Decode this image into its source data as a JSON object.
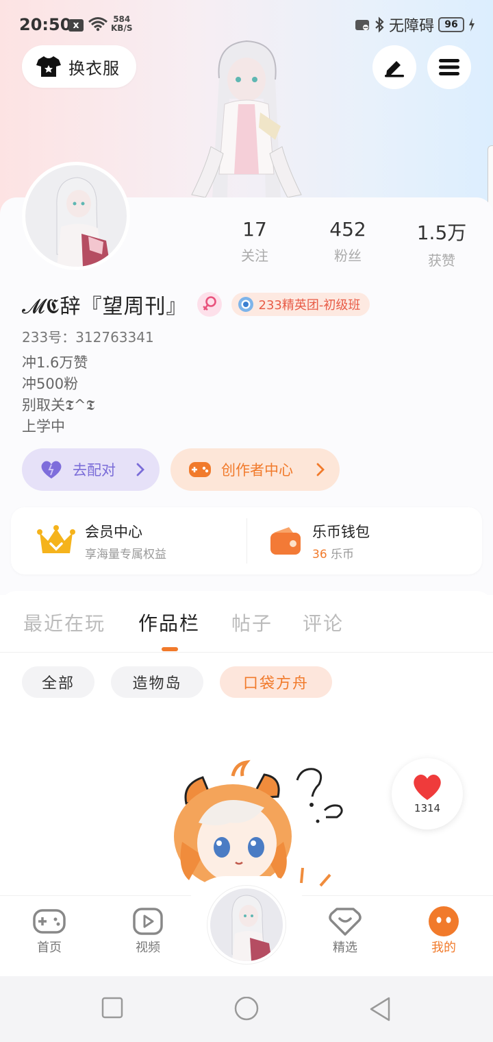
{
  "status_bar": {
    "time": "20:50",
    "notification_icon": "x",
    "net_speed_value": "584",
    "net_speed_unit": "KB/S",
    "accessibility": "无障碍",
    "battery": "96"
  },
  "header": {
    "outfit_label": "换衣服",
    "edit_icon": "pen-icon",
    "menu_icon": "hamburger-icon"
  },
  "profile": {
    "stats": [
      {
        "value": "17",
        "label": "关注"
      },
      {
        "value": "452",
        "label": "粉丝"
      },
      {
        "value": "1.5万",
        "label": "获赞"
      }
    ],
    "nickname": "𝓜𝕮辞『望周刊』",
    "badge": "233精英团-初级班",
    "uid": "233号：312763341",
    "bio_lines": [
      "冲1.6万赞",
      "冲500粉",
      "别取关𝕿^𝕿",
      "上学中"
    ],
    "pair_button": "去配对",
    "creator_button": "创作者中心"
  },
  "wallet_card": {
    "member_title": "会员中心",
    "member_sub": "享海量专属权益",
    "wallet_title": "乐币钱包",
    "wallet_amount": "36",
    "wallet_unit": "乐币"
  },
  "tabs": {
    "items": [
      "最近在玩",
      "作品栏",
      "帖子",
      "评论"
    ],
    "active": "作品栏"
  },
  "filters": {
    "items": [
      "全部",
      "造物岛",
      "口袋方舟"
    ],
    "active": "口袋方舟"
  },
  "floating": {
    "like_count": "1314"
  },
  "bottom_nav": {
    "items": [
      "首页",
      "视频",
      "精选",
      "我的"
    ],
    "active": "我的"
  },
  "colors": {
    "accent": "#f17a2b",
    "pair_purple": "#7a6cd8",
    "badge_red": "#e85c47"
  }
}
